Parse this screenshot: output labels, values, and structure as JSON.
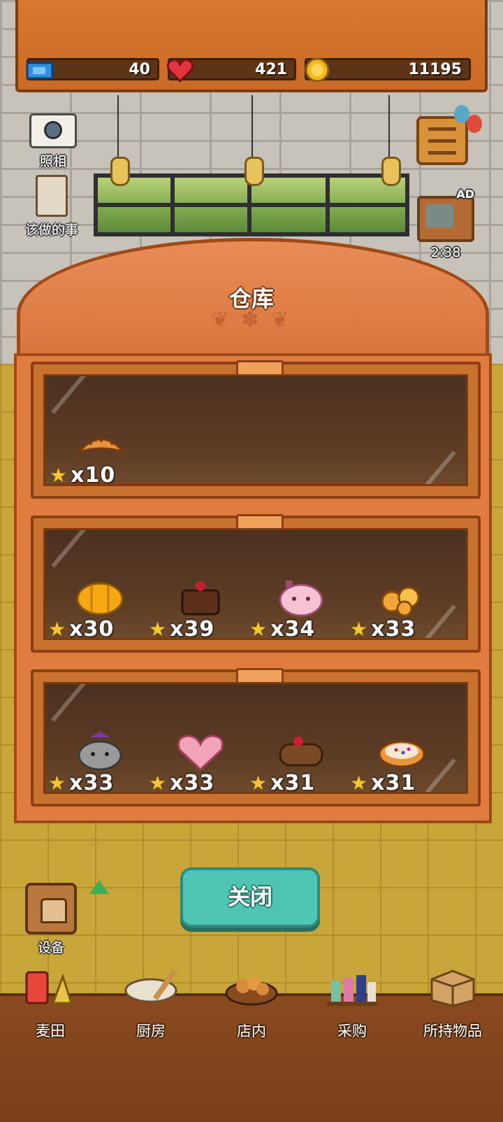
{
  "stats": {
    "tickets": "40",
    "hearts": "421",
    "coins": "11195"
  },
  "side": {
    "camera_label": "照相",
    "todo_label": "该做的事",
    "ad_badge": "AD",
    "ad_timer": "2:38",
    "equipment_label": "设备"
  },
  "warehouse": {
    "title": "仓库",
    "shelves": [
      {
        "items": [
          {
            "icon": "croissant",
            "count": "x10"
          }
        ]
      },
      {
        "items": [
          {
            "icon": "pumpkin-bread",
            "count": "x30"
          },
          {
            "icon": "chocolate-cake",
            "count": "x39"
          },
          {
            "icon": "pink-bunny-bun",
            "count": "x34"
          },
          {
            "icon": "cheese-puff",
            "count": "x33"
          }
        ]
      },
      {
        "items": [
          {
            "icon": "cat-bread",
            "count": "x33"
          },
          {
            "icon": "heart-cookie",
            "count": "x33"
          },
          {
            "icon": "cherry-eclair",
            "count": "x31"
          },
          {
            "icon": "sprinkle-tart",
            "count": "x31"
          }
        ]
      }
    ],
    "close_label": "关闭"
  },
  "nav": [
    {
      "label": "麦田",
      "icon": "wheat-field-icon"
    },
    {
      "label": "厨房",
      "icon": "kitchen-icon"
    },
    {
      "label": "店内",
      "icon": "store-icon"
    },
    {
      "label": "采购",
      "icon": "purchase-icon"
    },
    {
      "label": "所持物品",
      "icon": "inventory-icon"
    }
  ],
  "colors": {
    "wood": "#e07c3f",
    "close_button": "#4fc6b3",
    "star": "#f4c634"
  }
}
